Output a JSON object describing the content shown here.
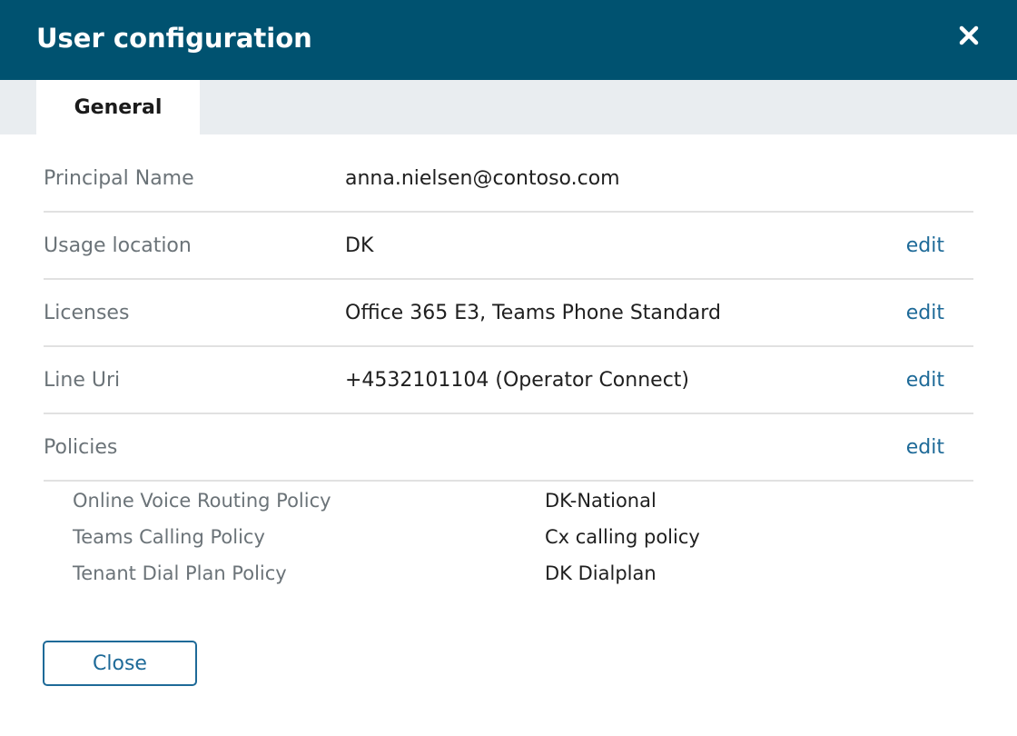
{
  "dialog": {
    "title": "User configuration",
    "close_icon": "close-icon"
  },
  "tabs": [
    {
      "label": "General",
      "active": true
    }
  ],
  "fields": {
    "principal_name": {
      "label": "Principal Name",
      "value": "anna.nielsen@contoso.com"
    },
    "usage_location": {
      "label": "Usage location",
      "value": "DK",
      "edit": "edit"
    },
    "licenses": {
      "label": "Licenses",
      "value": "Office 365 E3, Teams Phone Standard",
      "edit": "edit"
    },
    "line_uri": {
      "label": "Line Uri",
      "value": "+4532101104 (Operator Connect)",
      "edit": "edit"
    },
    "policies": {
      "label": "Policies",
      "edit": "edit"
    }
  },
  "policies": [
    {
      "name": "Online Voice Routing Policy",
      "value": "DK-National"
    },
    {
      "name": "Teams Calling Policy",
      "value": "Cx calling policy"
    },
    {
      "name": "Tenant Dial Plan Policy",
      "value": "DK Dialplan"
    }
  ],
  "footer": {
    "close_label": "Close"
  },
  "colors": {
    "header_bg": "#005270",
    "accent": "#1e6a98",
    "tabbar_bg": "#e9edf0",
    "label_gray": "#6b7378"
  }
}
